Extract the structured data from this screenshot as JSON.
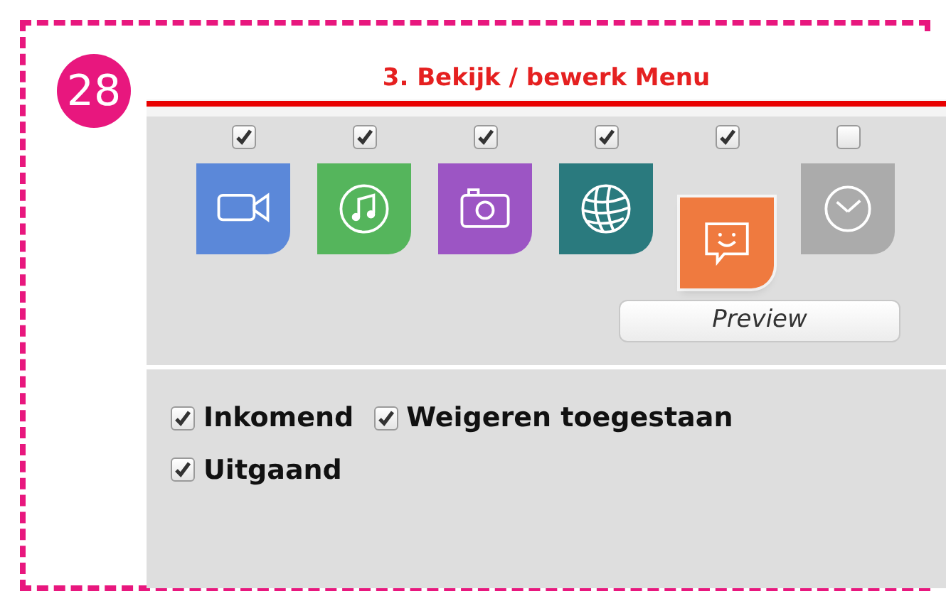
{
  "badge": "28",
  "panel": {
    "title": "3. Bekijk / bewerk Menu",
    "items": [
      {
        "kind": "video",
        "color": "#5b88d9",
        "checked": true,
        "selected": false
      },
      {
        "kind": "music",
        "color": "#55b55c",
        "checked": true,
        "selected": false
      },
      {
        "kind": "camera",
        "color": "#9c55c4",
        "checked": true,
        "selected": false
      },
      {
        "kind": "globe",
        "color": "#2a7a7e",
        "checked": true,
        "selected": false
      },
      {
        "kind": "chat",
        "color": "#ef7a3f",
        "checked": true,
        "selected": true
      },
      {
        "kind": "clock",
        "color": "#ababab",
        "checked": false,
        "selected": false
      }
    ],
    "preview_button": "Preview",
    "options": [
      {
        "label": "Inkomend",
        "checked": true
      },
      {
        "label": "Weigeren toegestaan",
        "checked": true
      },
      {
        "label": "Uitgaand",
        "checked": true
      }
    ]
  }
}
